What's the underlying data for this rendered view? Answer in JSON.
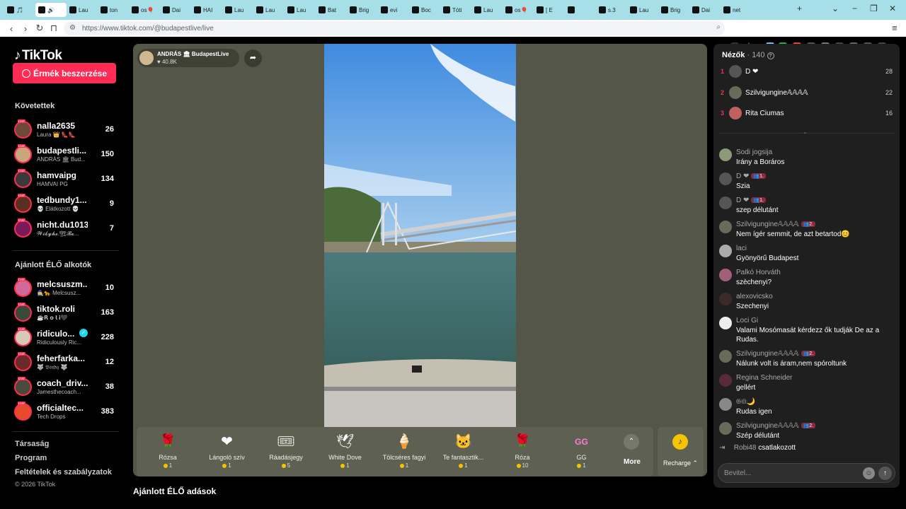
{
  "browser": {
    "tabs": [
      {
        "label": "🎵",
        "active": false
      },
      {
        "label": "🔊",
        "active": true
      },
      {
        "label": "Lau",
        "active": false
      },
      {
        "label": "ton",
        "active": false
      },
      {
        "label": "os🎈",
        "active": false
      },
      {
        "label": "Dai",
        "active": false
      },
      {
        "label": "HAI",
        "active": false
      },
      {
        "label": "Lau",
        "active": false
      },
      {
        "label": "Lau",
        "active": false
      },
      {
        "label": "Lau",
        "active": false
      },
      {
        "label": "Bat",
        "active": false
      },
      {
        "label": "Brig",
        "active": false
      },
      {
        "label": "evi",
        "active": false
      },
      {
        "label": "Boc",
        "active": false
      },
      {
        "label": "Tóti",
        "active": false
      },
      {
        "label": "Lau",
        "active": false
      },
      {
        "label": "os🎈",
        "active": false
      },
      {
        "label": "[ E",
        "active": false
      },
      {
        "label": "",
        "active": false
      },
      {
        "label": "s.3",
        "active": false
      },
      {
        "label": "Lau",
        "active": false
      },
      {
        "label": "Brig",
        "active": false
      },
      {
        "label": "Dai",
        "active": false
      },
      {
        "label": "net",
        "active": false
      }
    ],
    "new_tab": "+",
    "url": "https://www.tiktok.com/@budapestlive/live"
  },
  "sidebar": {
    "logo": "TikTok",
    "coins_button": "Érmék beszerzése",
    "following_title": "Követettek",
    "following": [
      {
        "name": "nalla2635",
        "sub": "Laura 👑 👠👠",
        "count": "26",
        "color": "#6b4a3a"
      },
      {
        "name": "budapestli...",
        "sub": "ANDRÁS 🏛 Bud...",
        "count": "150",
        "color": "#c9a77a"
      },
      {
        "name": "hamvaipg",
        "sub": "HAMVAI PG",
        "count": "134",
        "color": "#3a3a3a"
      },
      {
        "name": "tedbundy1...",
        "sub": "💀 Elátkozott 💀",
        "count": "9",
        "color": "#5a3020"
      },
      {
        "name": "nicht.du1013",
        "sub": "𝓦𝓲𝓴𝔂𝓱𝓮.🏗𝓑𝓮...",
        "count": "7",
        "color": "#7a1a5a"
      }
    ],
    "recommended_title": "Ajánlott ÉLŐ alkotók",
    "recommended": [
      {
        "name": "melcsuszm...",
        "sub": "🧙‍♀️🐆 Melcsusz...",
        "count": "10",
        "color": "#d06a9a"
      },
      {
        "name": "tiktok.roli",
        "sub": "☕𝗥 𝗼 𝗹 𝗶🖤",
        "count": "163",
        "color": "#3a4a3a"
      },
      {
        "name": "ridiculo...",
        "sub": "Ridiculously Ric...",
        "count": "228",
        "color": "#d8c8b8",
        "verified": true
      },
      {
        "name": "feherfarka...",
        "sub": "🐺 𝔅𝔦𝔫𝔡𝔶 🐺",
        "count": "12",
        "color": "#6a2a2a"
      },
      {
        "name": "coach_driv...",
        "sub": "Jamesthecoach...",
        "count": "38",
        "color": "#4a4a3a"
      },
      {
        "name": "officialtec...",
        "sub": "Tech Drops",
        "count": "383",
        "color": "#e84a2a"
      }
    ],
    "footer": [
      "Társaság",
      "Program",
      "Feltételek és szabályzatok"
    ],
    "copyright": "© 2026 TikTok"
  },
  "stream": {
    "host_name": "ANDRÁS 🏛 BudapestLive",
    "host_likes": "♥ 40.8K"
  },
  "gifts": [
    {
      "name": "Rózsa",
      "price": "1",
      "icon": "🌹",
      "icon_name": "rose-icon"
    },
    {
      "name": "Lángoló szív",
      "price": "1",
      "icon": "❤",
      "icon_name": "heart-icon"
    },
    {
      "name": "Ráadásjegy",
      "price": "5",
      "icon": "🎟",
      "icon_name": "ticket-icon"
    },
    {
      "name": "White Dove",
      "price": "1",
      "icon": "🕊",
      "icon_name": "dove-icon"
    },
    {
      "name": "Tölcséres fagyi",
      "price": "1",
      "icon": "🍦",
      "icon_name": "ice-cream-icon"
    },
    {
      "name": "Te fantasztik...",
      "price": "1",
      "icon": "🐱",
      "icon_name": "cat-icon"
    },
    {
      "name": "Róza",
      "price": "10",
      "icon": "🌹",
      "icon_name": "rose-icon"
    },
    {
      "name": "GG",
      "price": "1",
      "icon": "GG",
      "icon_name": "gg-icon"
    }
  ],
  "gift_more": "More",
  "recharge": "Recharge ⌃",
  "recommended_live_title": "Ajánlott ÉLŐ adások",
  "viewers": {
    "title": "Nézők",
    "count": "· 140",
    "top": [
      {
        "rank": "1",
        "name": "D ❤",
        "score": "28",
        "color": "#555"
      },
      {
        "rank": "2",
        "name": "Szilvigungine𝔸𝔸𝔸𝔸",
        "score": "22",
        "color": "#6a6a5a"
      },
      {
        "rank": "3",
        "name": "Rita Ciumas",
        "score": "16",
        "color": "#c06060"
      }
    ]
  },
  "chat": [
    {
      "user": "Sodi jogsija",
      "badge": "",
      "msg": "Irány a Boráros",
      "color": "#8a9a7a"
    },
    {
      "user": "D ❤",
      "badge": "👥1.",
      "msg": "Szia",
      "color": "#555"
    },
    {
      "user": "D ❤",
      "badge": "👥1.",
      "msg": "szep délutánt",
      "color": "#555"
    },
    {
      "user": "Szilvigungine𝔸𝔸𝔸𝔸",
      "badge": "👥2.",
      "msg": "Nem ígér semmit, de azt betartod😊",
      "color": "#6a6a5a"
    },
    {
      "user": "laci",
      "badge": "",
      "msg": "Gyönyörű Budapest",
      "color": "#aaa"
    },
    {
      "user": "Palkó Horváth",
      "badge": "",
      "msg": "szèchenyi?",
      "color": "#a0607a"
    },
    {
      "user": "alexovicsko",
      "badge": "",
      "msg": "Szechenyi",
      "color": "#3a2a2a"
    },
    {
      "user": "Loci Gi",
      "badge": "",
      "msg": "Valami Mosómasát kérdezz ők tudják De az a Rudas.",
      "color": "#eee"
    },
    {
      "user": "Szilvigungine𝔸𝔸𝔸𝔸",
      "badge": "👥2.",
      "msg": "Nálunk volt is áram,nem spóroltunk",
      "color": "#6a6a5a"
    },
    {
      "user": "Regina Schneider",
      "badge": "",
      "msg": "gellért",
      "color": "#5a2a3a"
    },
    {
      "user": "𝔊𝔦𝔩𝔦🌙",
      "badge": "",
      "msg": "Rudas igen",
      "color": "#888"
    },
    {
      "user": "Szilvigungine𝔸𝔸𝔸𝔸",
      "badge": "👥2.",
      "msg": "Szép délutánt",
      "color": "#6a6a5a"
    }
  ],
  "joined": {
    "user": "Robi48",
    "text": "csatlakozott"
  },
  "chat_input": {
    "placeholder": "Bevitel..."
  }
}
